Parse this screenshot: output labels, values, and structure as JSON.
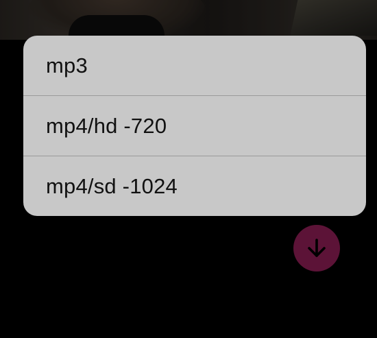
{
  "format_menu": {
    "options": [
      {
        "label": "mp3"
      },
      {
        "label": "mp4/hd -720"
      },
      {
        "label": "mp4/sd -1024"
      }
    ]
  },
  "download_button": {
    "icon": "arrow-down-icon",
    "color": "#5c1337"
  },
  "colors": {
    "background": "#000000",
    "menu_background": "#c8c8c8",
    "menu_text": "#111111",
    "divider": "#9a9a9a"
  }
}
